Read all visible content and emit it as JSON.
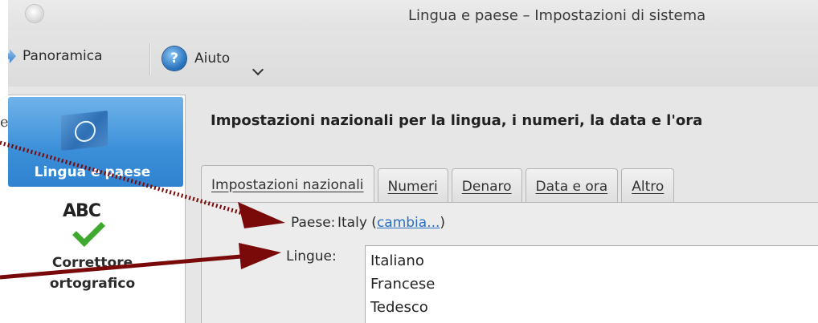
{
  "window": {
    "title": "Lingua e paese – Impostazioni di sistema"
  },
  "toolbar": {
    "overview_label": "Panoramica",
    "help_label": "Aiuto",
    "help_glyph": "?"
  },
  "sidebar": {
    "items": [
      {
        "label": "Lingua e paese",
        "icon": "un-flag-icon",
        "active": true
      },
      {
        "label_line1": "Correttore",
        "label_line2": "ortografico",
        "icon": "spellcheck-icon",
        "icon_text": "ABC"
      }
    ]
  },
  "main": {
    "heading": "Impostazioni nazionali per la lingua, i numeri, la data e l'ora",
    "tabs": [
      {
        "label": "Impostazioni nazionali",
        "active": true
      },
      {
        "label": "Numeri"
      },
      {
        "label": "Denaro"
      },
      {
        "label": "Data e ora"
      },
      {
        "label": "Altro"
      }
    ],
    "country": {
      "label": "Paese:",
      "value": "Italy",
      "link": "cambia...",
      "open_paren": " (",
      "close_paren": ")"
    },
    "languages": {
      "label": "Lingue:",
      "items": [
        "Italiano",
        "Francese",
        "Tedesco"
      ]
    }
  },
  "annotation": {
    "arrow_color": "#7a0a0a",
    "edge_text": "e"
  }
}
